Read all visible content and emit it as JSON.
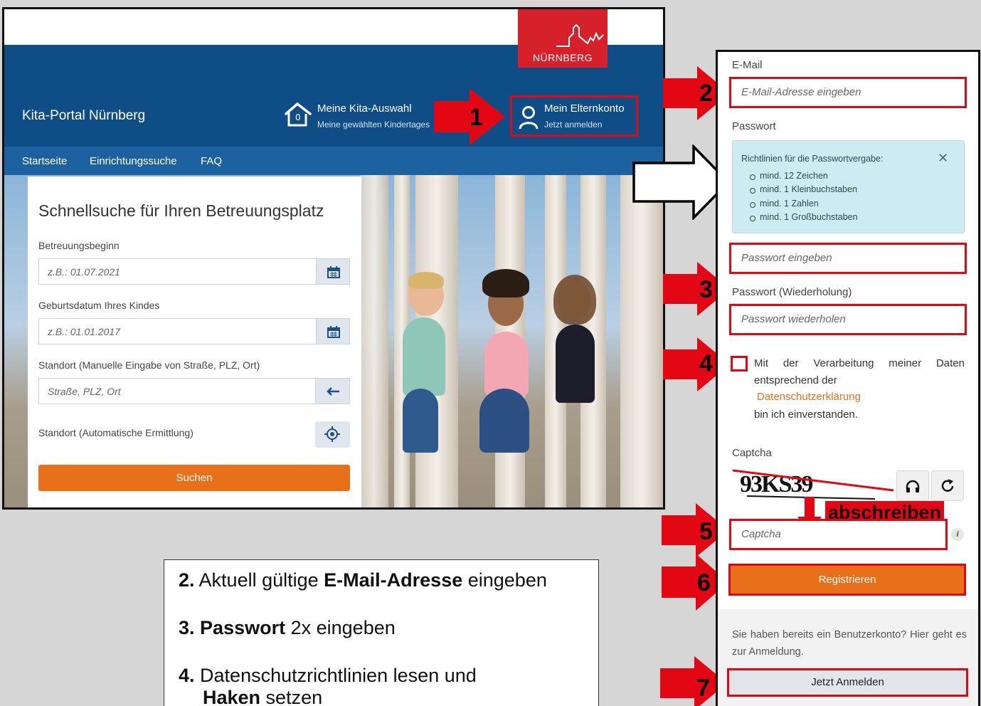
{
  "site": {
    "logo_text": "NÜRNBERG",
    "portal_title": "Kita-Portal Nürnberg",
    "kita_selection": {
      "count": "0",
      "title": "Meine Kita-Auswahl",
      "subtitle": "Meine gewählten Kindertages"
    },
    "account": {
      "title": "Mein Elternkonto",
      "subtitle": "Jetzt anmelden"
    },
    "nav": [
      "Startseite",
      "Einrichtungssuche",
      "FAQ"
    ]
  },
  "search": {
    "heading": "Schnellsuche für Ihren Betreuungsplatz",
    "start_label": "Betreuungsbeginn",
    "start_placeholder": "z.B.: 01.07.2021",
    "birth_label": "Geburtsdatum Ihres Kindes",
    "birth_placeholder": "z.B.: 01.01.2017",
    "location_label": "Standort (Manuelle Eingabe von Straße, PLZ, Ort)",
    "location_placeholder": "Straße, PLZ, Ort",
    "auto_location_label": "Standort (Automatische Ermittlung)",
    "submit": "Suchen"
  },
  "register": {
    "email_label": "E-Mail",
    "email_placeholder": "E-Mail-Adresse eingeben",
    "password_label": "Passwort",
    "pw_rules_title": "Richtlinien für die Passwortvergabe:",
    "pw_rules": [
      "mind. 12 Zeichen",
      "mind. 1 Kleinbuchstaben",
      "mind. 1 Zahlen",
      "mind. 1 Großbuchstaben"
    ],
    "password_placeholder": "Passwort eingeben",
    "password_repeat_label": "Passwort (Wiederholung)",
    "password_repeat_placeholder": "Passwort wiederholen",
    "consent_words": [
      "Mit",
      "der",
      "Verarbeitung",
      "meiner",
      "Daten"
    ],
    "consent_line2": "entsprechend der",
    "privacy_link": "Datenschutzerklärung",
    "consent_line4": "bin ich einverstanden.",
    "captcha_label": "Captcha",
    "captcha_image_text": "93KS39",
    "captcha_placeholder": "Captcha",
    "submit": "Registrieren",
    "login_hint": "Sie haben bereits ein Benutzerkonto? Hier geht es zur Anmeldung.",
    "login_button": "Jetzt Anmelden"
  },
  "annotations": {
    "step_numbers": [
      "1",
      "2",
      "3",
      "4",
      "5",
      "6",
      "7"
    ],
    "copy_hint": "abschreiben",
    "instructions": [
      {
        "num": "2.",
        "pre": " Aktuell gültige ",
        "bold": "E-Mail-Adresse",
        "post": " eingeben"
      },
      {
        "num": "3.",
        "pre": " ",
        "bold": "Passwort",
        "post": " 2x eingeben"
      },
      {
        "num": "4.",
        "line1": " Datenschutzrichtlinien lesen und",
        "bold": "Haken",
        "post": " setzen"
      }
    ]
  },
  "colors": {
    "header_blue": "#0f4d86",
    "nav_blue": "#1d62a0",
    "brand_red": "#d6202a",
    "highlight_red": "#e30613",
    "accent_orange": "#e8701a",
    "info_bg": "#cdebf1"
  }
}
